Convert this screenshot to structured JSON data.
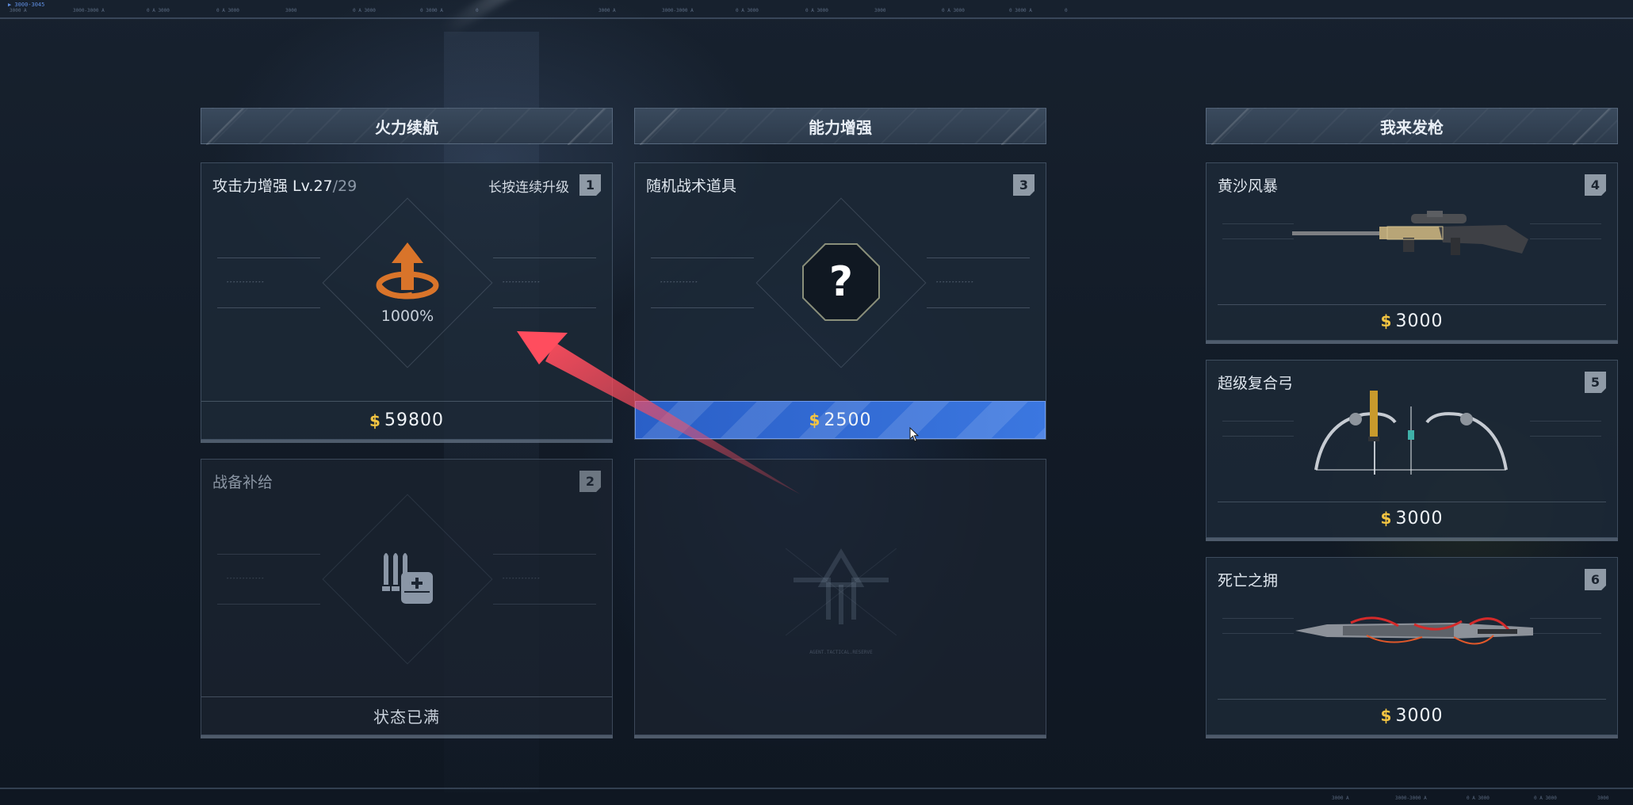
{
  "top_ruler": {
    "tag": "▶ 3000-3045",
    "ticks": [
      "3000 A",
      "3000-3000 A",
      "0 A 3000",
      "0 A 3000",
      "3000",
      "0 A 3000",
      "0 3000 A",
      "0",
      "3000 A",
      "3000-3000 A",
      "0 A 3000",
      "0 A 3000",
      "3000",
      "0 A 3000",
      "0 3000 A",
      "0"
    ]
  },
  "bottom_ruler": {
    "ticks": [
      "3000 A",
      "3000-3000 A",
      "0 A 3000",
      "0 A 3000",
      "3000"
    ]
  },
  "columns": [
    {
      "header": "火力续航"
    },
    {
      "header": "能力增强"
    },
    {
      "header": "我来发枪"
    }
  ],
  "cards": {
    "attack": {
      "title": "攻击力增强 ",
      "level_prefix": "Lv.27",
      "level_max": "/29",
      "hint": "长按连续升级",
      "badge": "1",
      "percent": "1000%",
      "currency": "$",
      "price": "59800"
    },
    "supply": {
      "title": "战备补给",
      "badge": "2",
      "status": "状态已满"
    },
    "random": {
      "title": "随机战术道具",
      "badge": "3",
      "symbol": "?",
      "currency": "$",
      "price": "2500"
    },
    "locked_watermark": "AGENT.TACTICAL.RESERVE",
    "weapons": [
      {
        "title": "黄沙风暴",
        "badge": "4",
        "currency": "$",
        "price": "3000",
        "icon": "sniper-rifle-icon"
      },
      {
        "title": "超级复合弓",
        "badge": "5",
        "currency": "$",
        "price": "3000",
        "icon": "compound-bow-icon"
      },
      {
        "title": "死亡之拥",
        "badge": "6",
        "currency": "$",
        "price": "3000",
        "icon": "red-blade-icon"
      }
    ]
  },
  "colors": {
    "accent_blue": "#3b77e0",
    "coin_gold": "#f4c542",
    "upgrade_orange": "#d9742a",
    "arrow_red": "#ff4d5e"
  }
}
